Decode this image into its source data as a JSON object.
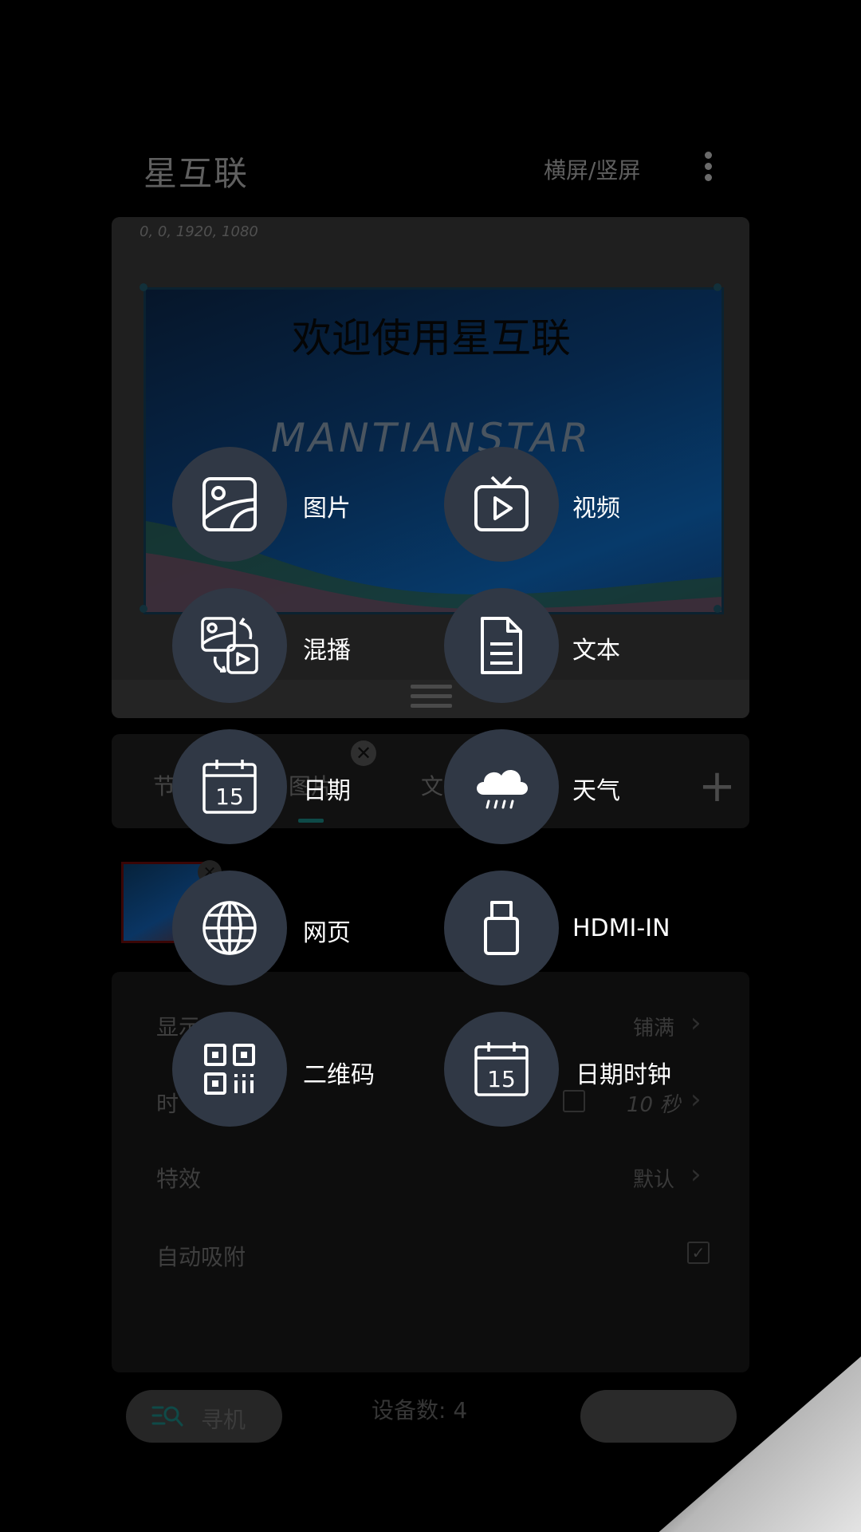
{
  "header": {
    "app_title": "星互联",
    "orientation_label": "横屏/竖屏",
    "more_icon": "more-vertical-icon"
  },
  "preview": {
    "coords": "0, 0, 1920, 1080",
    "welcome_text": "欢迎使用星互联",
    "brand_text": "MANTIANSTAR"
  },
  "tabs": {
    "items": [
      "节",
      "图片",
      "文"
    ],
    "add_icon": "plus-icon"
  },
  "settings": {
    "rows": [
      {
        "label": "显示",
        "value": "铺满"
      },
      {
        "label": "时",
        "value": "10 秒"
      },
      {
        "label": "特效",
        "value": "默认"
      },
      {
        "label": "自动吸附",
        "value": ""
      }
    ]
  },
  "bottom": {
    "search_label": "寻机",
    "device_count_label": "设备数:  4"
  },
  "menu": {
    "items": [
      {
        "label": "图片",
        "icon": "image-icon"
      },
      {
        "label": "视频",
        "icon": "tv-play-icon"
      },
      {
        "label": "混播",
        "icon": "mixed-play-icon"
      },
      {
        "label": "文本",
        "icon": "document-icon"
      },
      {
        "label": "日期",
        "icon": "calendar-icon"
      },
      {
        "label": "天气",
        "icon": "weather-rain-icon"
      },
      {
        "label": "网页",
        "icon": "globe-icon"
      },
      {
        "label": "HDMI-IN",
        "icon": "usb-icon"
      },
      {
        "label": "二维码",
        "icon": "qr-code-icon"
      },
      {
        "label": "日期时钟",
        "icon": "calendar-clock-icon"
      }
    ],
    "calendar_day": "15",
    "colors": {
      "fab_bg": "#303845",
      "label": "#ffffff",
      "backdrop": "#000000"
    }
  }
}
